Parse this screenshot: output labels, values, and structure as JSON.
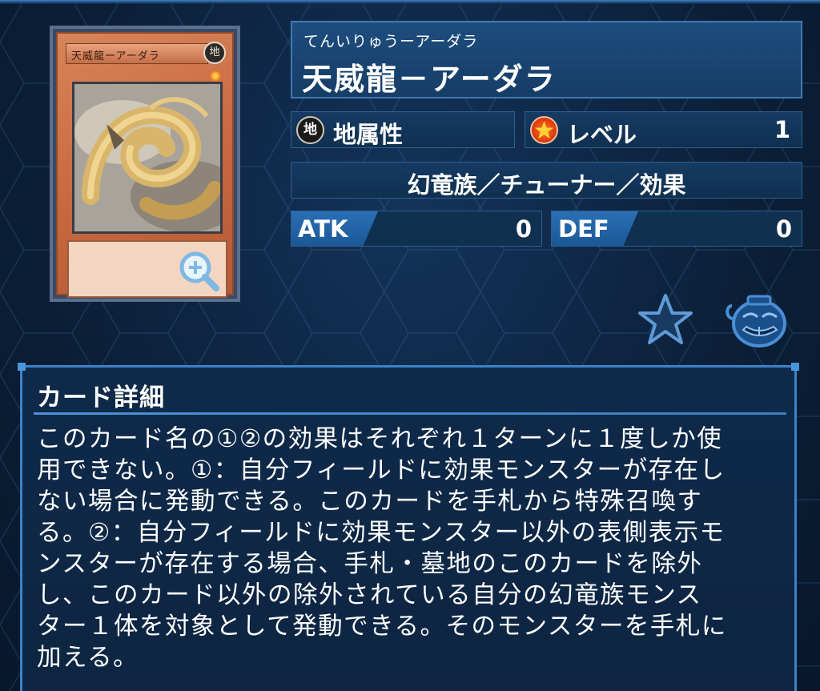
{
  "card": {
    "image_name_text": "天威龍ーアーダラ",
    "image_attribute_glyph": "地"
  },
  "header": {
    "kana": "てんいりゅうーアーダラ",
    "name": "天威龍－アーダラ"
  },
  "attribute": {
    "icon": "earth-attribute-icon",
    "icon_glyph": "地",
    "label": "地属性"
  },
  "level": {
    "icon": "level-star-icon",
    "label": "レベル",
    "value": "1"
  },
  "type_line": "幻竜族／チューナー／効果",
  "atk": {
    "label": "ATK",
    "value": "0"
  },
  "def": {
    "label": "DEF",
    "value": "0"
  },
  "actions": {
    "favorite_icon": "star-icon",
    "pot_icon": "pot-of-greed-icon"
  },
  "detail": {
    "title": "カード詳細",
    "text": "このカード名の①②の効果はそれぞれ１ターンに１度しか使\n用できない。①：自分フィールドに効果モンスターが存在し\nない場合に発動できる。このカードを手札から特殊召喚す\nる。②：自分フィールドに効果モンスター以外の表側表示モ\nンスターが存在する場合、手札・墓地のこのカードを除外\nし、このカード以外の除外されている自分の幻竜族モンス\nター１体を対象として発動できる。そのモンスターを手札に\n加える。"
  },
  "colors": {
    "background": "#0c2038",
    "panel_border": "#3f79b3",
    "accent_blue": "#2a6fb5",
    "card_frame_orange": "#c86a42"
  }
}
